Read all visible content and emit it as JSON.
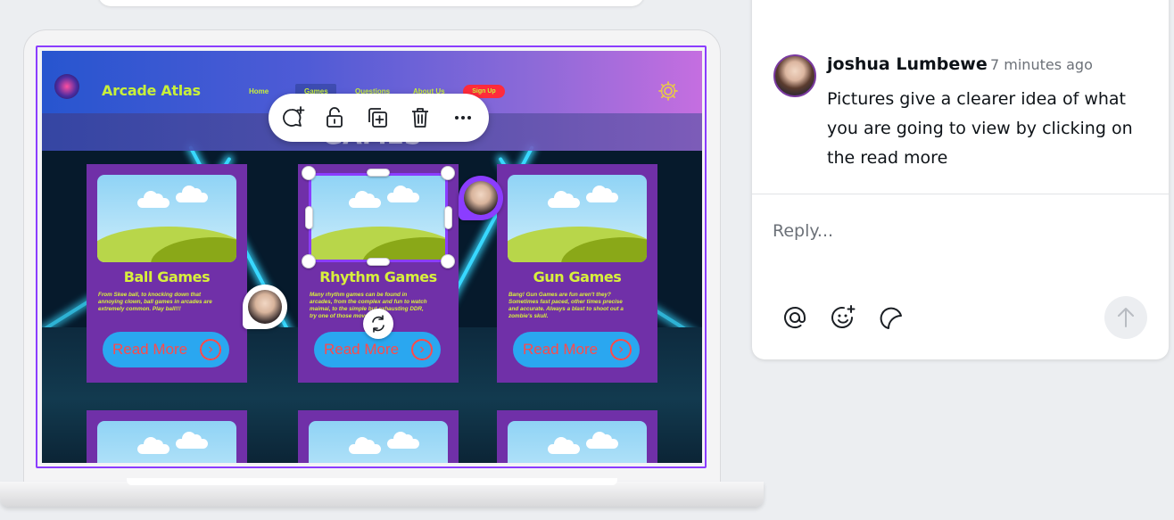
{
  "site": {
    "logo_text": "Arcade Atlas",
    "nav": [
      "Home",
      "Games",
      "Questions",
      "About Us"
    ],
    "signup": "Sign Up",
    "banner": "GAMES"
  },
  "cards": [
    {
      "title": "Ball Games",
      "desc": "From Skee ball, to knocking down that annoying clown, ball games in arcades are extremely common. Play ball!!!",
      "button": "Read More"
    },
    {
      "title": "Rhythm Games",
      "desc": "Many rhythm games can be found in arcades, from the complex and fun to watch maimai, to the simple but exhausting DDR, try one of those moves!",
      "button": "Read More"
    },
    {
      "title": "Gun Games",
      "desc": "Bang! Gun Games are fun aren't they? Sometimes fast paced, other times precise and accurate. Always a blast to shoot out a zombie's skull.",
      "button": "Read More"
    }
  ],
  "toolbar": {
    "icons": [
      "add-comment-icon",
      "lock-icon",
      "duplicate-icon",
      "trash-icon",
      "more-icon"
    ]
  },
  "comment": {
    "author": "joshua Lumbewe",
    "time": "7 minutes ago",
    "text": "Pictures give a clearer idea of what you are going to view by clicking on the read more",
    "reply_placeholder": "Reply..."
  },
  "colors": {
    "accent": "#8b3dff",
    "card_bg": "#7030a8",
    "title_lime": "#d8f03c",
    "button_blue": "#2aa7f0",
    "button_text": "#ff4a4a"
  }
}
